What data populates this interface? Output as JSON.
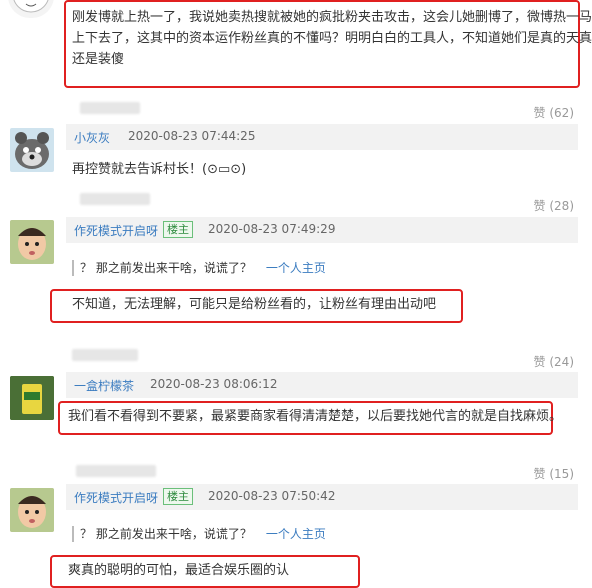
{
  "top_comment": {
    "text_lines": [
      "刚发博就上热一了，我说她卖热搜就被她的疯批粉夹击攻击，这会儿她删博了，微博热一马",
      "上下去了，这其中的资本运作粉丝真的不懂吗？明明白白的工具人，不知道她们是真的天真",
      "还是装傻"
    ],
    "likes": "赞 (62)"
  },
  "comment1": {
    "username": "小灰灰",
    "time": "2020-08-23 07:44:25",
    "text": "再控赞就去告诉村长！(⊙▭⊙)",
    "likes": "赞 (28)"
  },
  "comment2": {
    "username": "作死模式开启呀",
    "badge": "楼主",
    "time": "2020-08-23 07:49:29",
    "quote": "？ 那之前发出来干啥，说谎了？",
    "quote_link": "一个人主页",
    "reply": "不知道，无法理解，可能只是给粉丝看的，让粉丝有理由出动吧",
    "likes": "赞 (24)"
  },
  "comment3": {
    "username": "一盒柠檬茶",
    "time": "2020-08-23 08:06:12",
    "text": "我们看不看得到不要紧，最紧要商家看得清清楚楚，以后要找她代言的就是自找麻烦。",
    "likes": "赞 (15)"
  },
  "comment4": {
    "username": "作死模式开启呀",
    "badge": "楼主",
    "time": "2020-08-23 07:50:42",
    "quote": "？ 那之前发出来干啥，说谎了？",
    "quote_link": "一个人主页",
    "reply": "爽真的聪明的可怕，最适合娱乐圈的认"
  },
  "colors": {
    "highlight": "#e02020",
    "username": "#3b7cc0",
    "meta_bar": "#f2f2f2"
  }
}
